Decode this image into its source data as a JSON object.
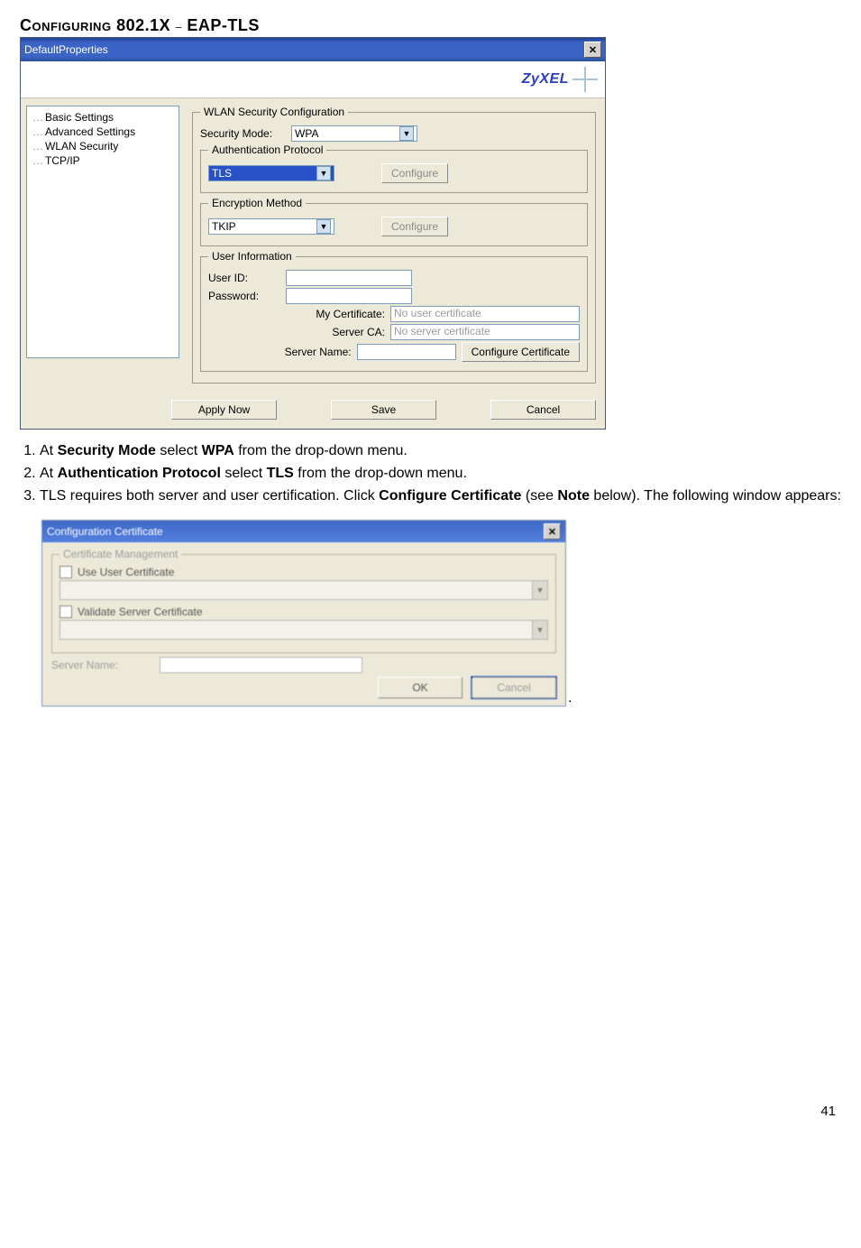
{
  "heading": {
    "configuring": "Configuring",
    "code": "802.1X",
    "dash": "–",
    "eap": "EAP-TLS"
  },
  "win1_title": "DefaultProperties",
  "logo_text": "ZyXEL",
  "tree_items": [
    "Basic Settings",
    "Advanced Settings",
    "WLAN Security",
    "TCP/IP"
  ],
  "grp_wlan": "WLAN Security Configuration",
  "lbl_secmode": "Security Mode:",
  "val_secmode": "WPA",
  "grp_auth": "Authentication Protocol",
  "val_auth": "TLS",
  "btn_config1": "Configure",
  "grp_enc": "Encryption Method",
  "val_enc": "TKIP",
  "btn_config2": "Configure",
  "grp_user": "User Information",
  "lbl_userid": "User ID:",
  "lbl_pw": "Password:",
  "lbl_mycert": "My Certificate:",
  "val_mycert": "No user certificate",
  "lbl_serverca": "Server CA:",
  "val_serverca": "No server certificate",
  "lbl_servername": "Server Name:",
  "btn_configcert": "Configure Certificate",
  "btn_apply": "Apply Now",
  "btn_save": "Save",
  "btn_cancel": "Cancel",
  "step1_a": "At ",
  "step1_b": "Security Mode",
  "step1_c": " select ",
  "step1_d": "WPA",
  "step1_e": " from the drop-down menu.",
  "step2_a": "At ",
  "step2_b": "Authentication Protocol",
  "step2_c": " select ",
  "step2_d": "TLS",
  "step2_e": " from the drop-down menu.",
  "step3_a": "TLS requires both server and user certification. Click ",
  "step3_b": "Configure Certificate",
  "step3_c": " (see ",
  "step3_d": "Note",
  "step3_e": " below). The following window appears:",
  "win2_title": "Configuration Certificate",
  "grp_certmgmt": "Certificate Management",
  "chk_usercert": "Use User Certificate",
  "chk_validate": "Validate Server Certificate",
  "lbl_servername2": "Server Name:",
  "btn_ok": "OK",
  "btn_cancel2": "Cancel",
  "page_number": "41"
}
